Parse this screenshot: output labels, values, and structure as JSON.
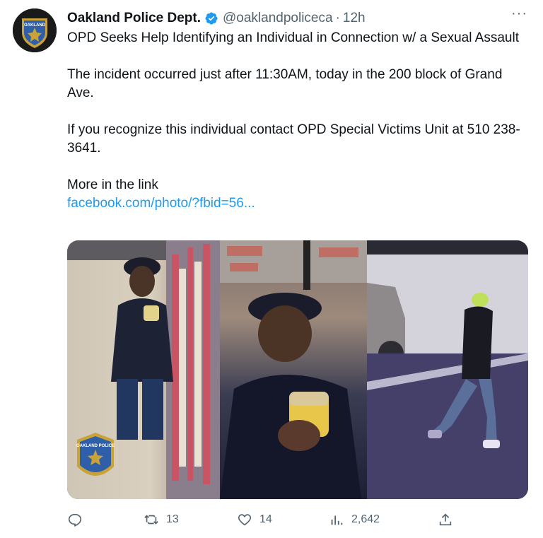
{
  "account": {
    "name": "Oakland Police Dept.",
    "handle": "@oaklandpoliceca",
    "separator": "·",
    "time": "12h",
    "avatar_icon": "police-badge-icon",
    "badge_text": "OAKLAND POLICE"
  },
  "menu": {
    "more_label": "···"
  },
  "tweet": {
    "paragraphs": [
      "OPD Seeks Help Identifying an Individual in Connection w/ a Sexual Assault",
      "The incident occurred just after 11:30AM, today in the 200 block of Grand Ave.",
      "If you recognize this individual contact OPD Special Victims Unit at 510 238-3641."
    ],
    "more_text": "More in the link",
    "link_text": "facebook.com/photo/?fbid=56..."
  },
  "media": {
    "watermark_text": "OAKLAND POLICE"
  },
  "actions": {
    "reply_count": "",
    "retweet_count": "13",
    "like_count": "14",
    "views_count": "2,642"
  },
  "colors": {
    "text": "#0f1419",
    "secondary": "#536471",
    "link": "#1d9bf0",
    "verified": "#1d9bf0"
  }
}
